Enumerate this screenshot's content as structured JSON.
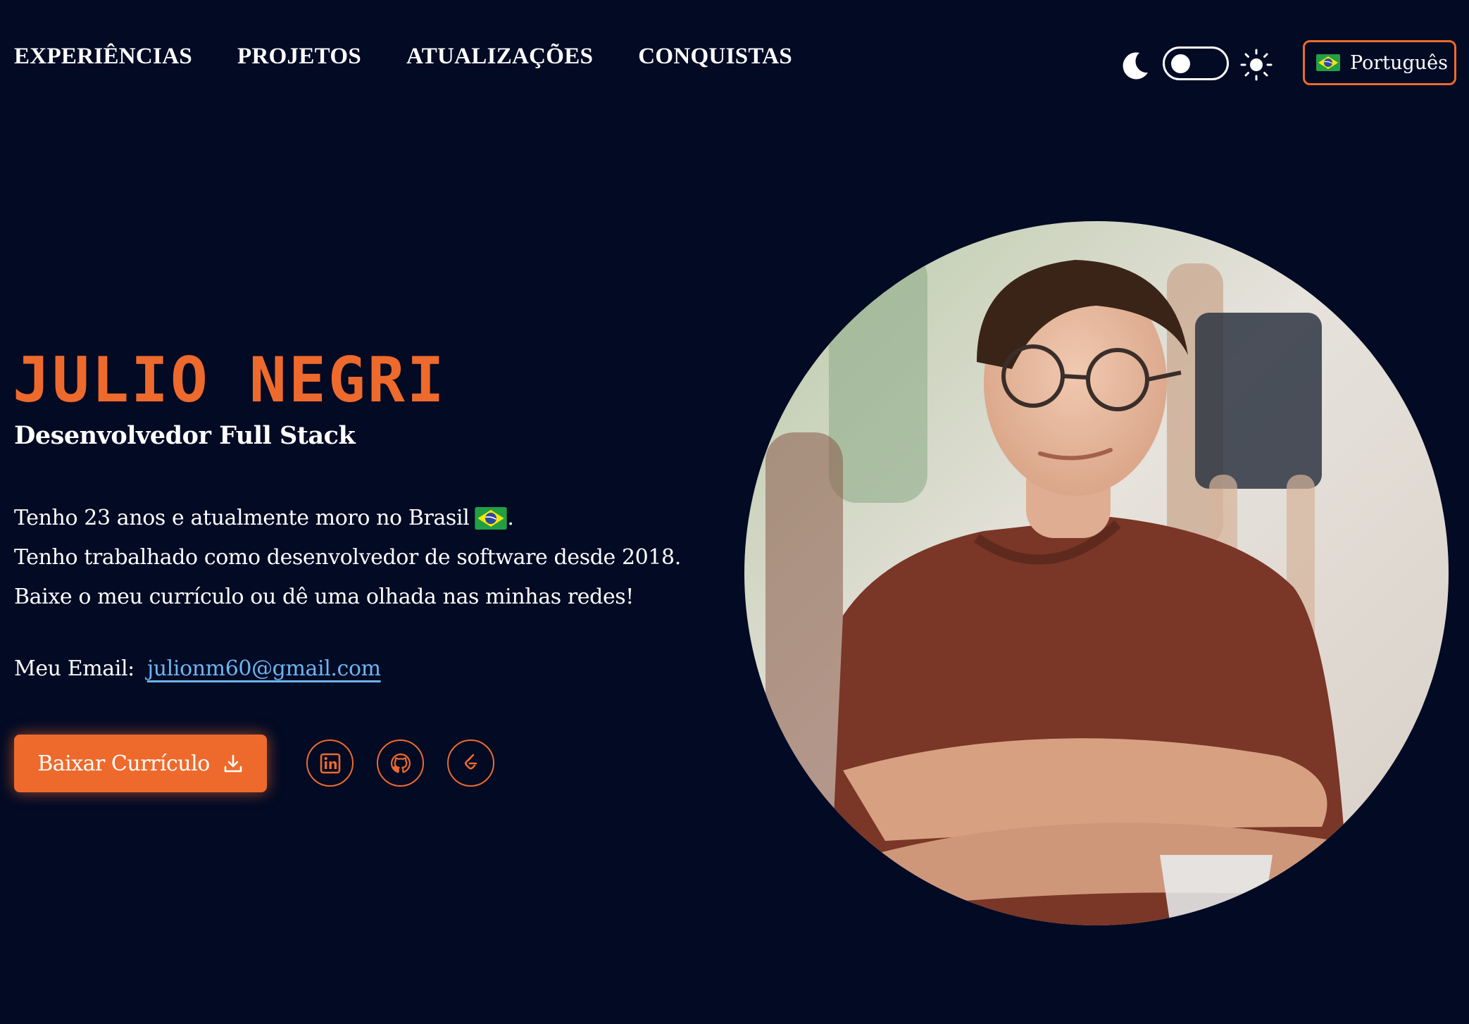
{
  "nav": {
    "items": [
      {
        "label": "EXPERIÊNCIAS"
      },
      {
        "label": "PROJETOS"
      },
      {
        "label": "ATUALIZAÇÕES"
      },
      {
        "label": "CONQUISTAS"
      }
    ]
  },
  "theme": {
    "dark_icon": "moon-icon",
    "light_icon": "sun-icon",
    "toggle_state": "dark"
  },
  "language": {
    "label": "Português",
    "flag_icon": "brazil-flag-icon"
  },
  "hero": {
    "name": "JULIO NEGRI",
    "role": "Desenvolvedor Full Stack",
    "bio_line_1": "Tenho 23 anos e atualmente moro no Brasil",
    "bio_line_1_end": ".",
    "bio_line_2": "Tenho trabalhado como desenvolvedor de software desde 2018.",
    "bio_line_3": "Baixe o meu currículo ou dê uma olhada nas minhas redes!",
    "email_label": "Meu Email:",
    "email": "julionm60@gmail.com",
    "cv_button": "Baixar Currículo",
    "cv_icon": "download-icon"
  },
  "social": [
    {
      "icon": "linkedin-icon"
    },
    {
      "icon": "github-icon"
    },
    {
      "icon": "leetcode-icon"
    }
  ],
  "colors": {
    "background": "#020a24",
    "accent": "#ee6a2c",
    "link": "#6cb6f2",
    "text": "#ffffff"
  }
}
